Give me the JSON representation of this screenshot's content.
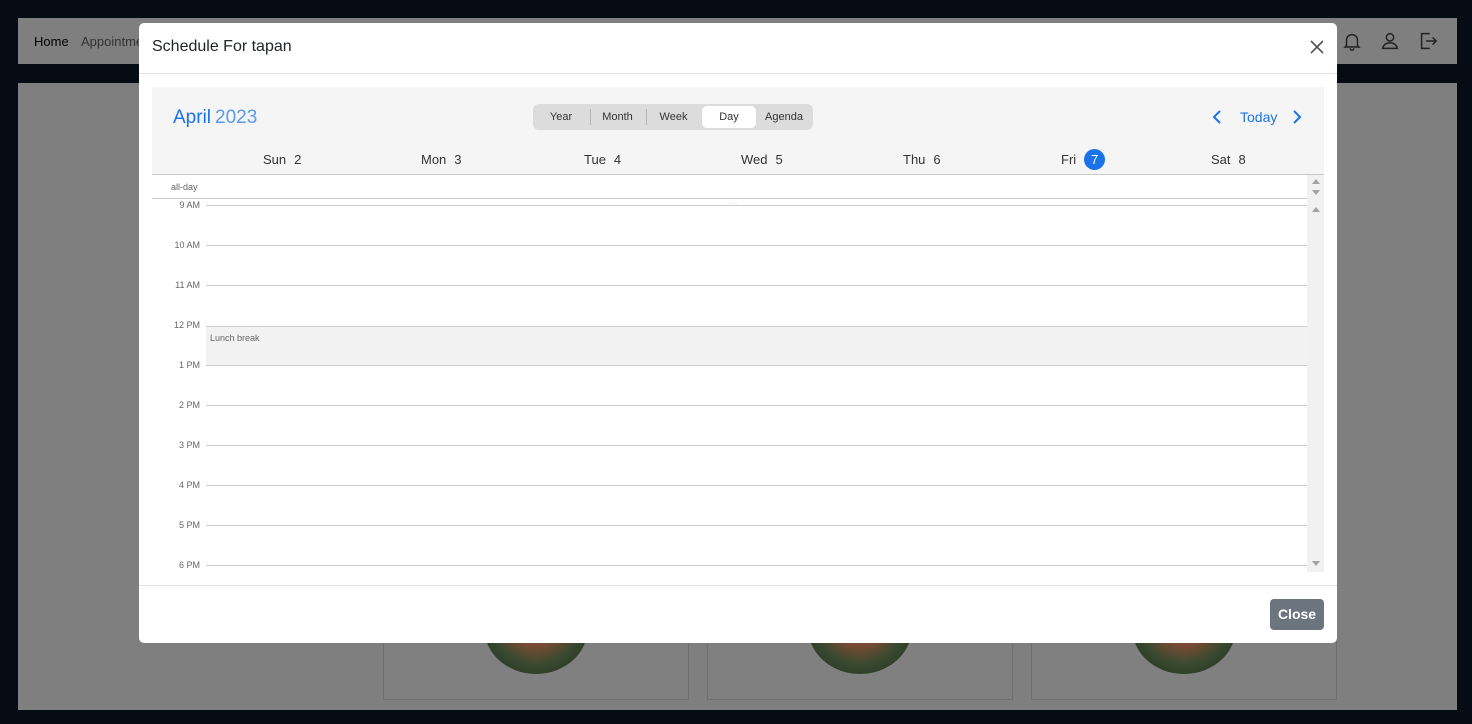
{
  "background": {
    "nav": {
      "home": "Home",
      "appointments": "Appointme"
    }
  },
  "modal": {
    "title": "Schedule For tapan",
    "close_label": "Close"
  },
  "scheduler": {
    "month": "April",
    "year": "2023",
    "views": [
      "Year",
      "Month",
      "Week",
      "Day",
      "Agenda"
    ],
    "active_view": "Day",
    "today_label": "Today",
    "days": [
      {
        "name": "Sun",
        "num": "2"
      },
      {
        "name": "Mon",
        "num": "3"
      },
      {
        "name": "Tue",
        "num": "4"
      },
      {
        "name": "Wed",
        "num": "5"
      },
      {
        "name": "Thu",
        "num": "6"
      },
      {
        "name": "Fri",
        "num": "7",
        "today": true
      },
      {
        "name": "Sat",
        "num": "8"
      }
    ],
    "allday_label": "all-day",
    "times": [
      "9 AM",
      "10 AM",
      "11 AM",
      "12 PM",
      "1 PM",
      "2 PM",
      "3 PM",
      "4 PM",
      "5 PM",
      "6 PM"
    ],
    "lunch_label": "Lunch break",
    "accent_color": "#1a73e8"
  }
}
